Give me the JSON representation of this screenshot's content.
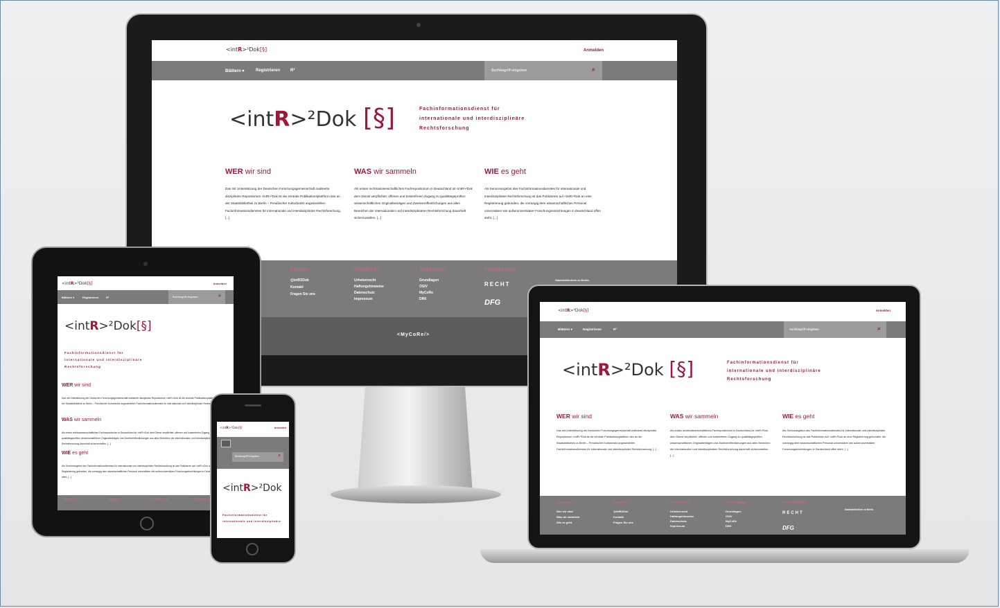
{
  "site": {
    "logo_prefix": "<int",
    "logo_r": "R",
    "logo_suffix": ">²Dok",
    "logo_section": "[§]",
    "login": "Anmelden",
    "nav_browse": "Blättern ▾",
    "nav_register": "Registrieren",
    "nav_icon": "R²",
    "search_placeholder": "Suchbegriff eingeben",
    "tagline": [
      "Fachinformationsdienst für",
      "internationale und interdisziplinäre",
      "Rechtsforschung"
    ],
    "columns": [
      {
        "heading_caps": "WER",
        "heading_rest": " wir sind",
        "text": "Das mit Unterstützung der Deutschen Forschungsgemeinschaft realisierte disziplinäre Repositorium <intR>²Dok ist die zentrale Publikationsplattform des an der Staatsbibliothek zu Berlin – Preußischer Kulturbesitz angesiedelten Fachinformationsdienstes für internationale und interdisziplinäre Rechtsforschung. [...]"
      },
      {
        "heading_caps": "WAS",
        "heading_rest": " wir sammeln",
        "text": "Als erstes rechtswissenschaftliches Fachrepositorium in Deutschland ist <intR>²Dok dem Dienst verpflichtet, offenen und kostenfreien Zugang zu qualitätsgeprüften wissenschaftlichen Originalbeiträgen und Zweitveröffentlichungen aus allen Bereichen der internationalen und interdisziplinären Rechtsforschung dauerhaft sicherzustellen. [...]"
      },
      {
        "heading_caps": "WIE",
        "heading_rest": " es geht",
        "text": "Als Serviceangebot des Fachinformationsdienstes für internationale und interdisziplinäre Rechtsforschung ist das Publizieren auf <intR>²Dok an eine Registrierung gebunden, die vorrangig dem wissenschaftlichen Personal universitärer wie außeruniversitärer Forschungseinrichtungen in Deutschland offen steht. [...]"
      }
    ],
    "footer": {
      "about": {
        "title": "Über uns",
        "items": [
          "Wer wir sind",
          "Was wir sammeln",
          "Wie es geht"
        ]
      },
      "social": {
        "title": "Soziales",
        "items": [
          "@intR2Dok",
          "Kontakt",
          "Fragen Sie uns"
        ]
      },
      "legal": {
        "title": "Rechtliches",
        "items": [
          "Urheberrecht",
          "Haftungshinweise",
          "Datenschutz",
          "Impressum"
        ]
      },
      "tech": {
        "title": "Technisches",
        "items": [
          "Grundlagen",
          "OSIV",
          "MyCoRe",
          "DINI"
        ]
      },
      "inst": {
        "title": "Institutionelles",
        "items": [
          "RECHT",
          "DFG",
          "Staatsbibliothek zu Berlin"
        ]
      },
      "powered": "<MyCoRe/>"
    }
  },
  "colors": {
    "accent": "#9b1a3a",
    "nav": "#7b7b7b",
    "footer": "#7b7b7b",
    "background": "#e8e9ea"
  }
}
